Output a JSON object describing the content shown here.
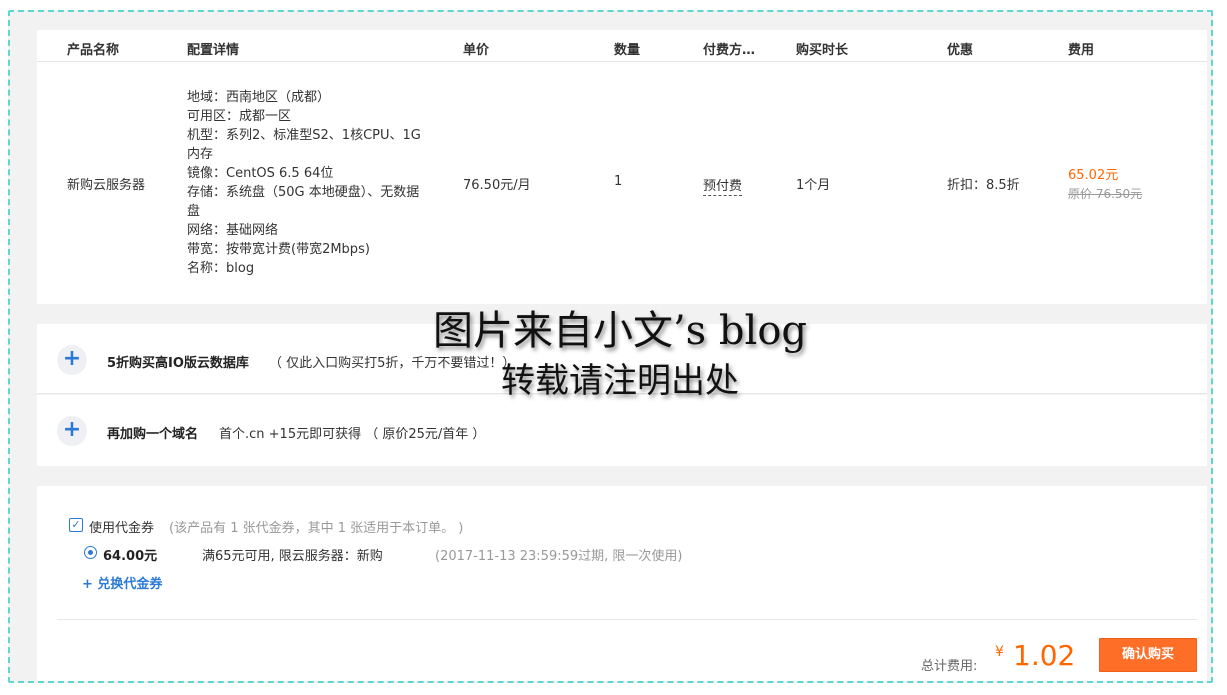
{
  "table": {
    "headers": [
      "产品名称",
      "配置详情",
      "单价",
      "数量",
      "付费方…",
      "购买时长",
      "优惠",
      "费用"
    ],
    "row": {
      "product": "新购云服务器",
      "config_lines": [
        "地域：西南地区（成都）",
        "可用区：成都一区",
        "机型：系列2、标准型S2、1核CPU、1G",
        "内存",
        "镜像：CentOS 6.5 64位",
        "存储：系统盘（50G 本地硬盘）、无数据",
        "盘",
        "网络：基础网络",
        "带宽：按带宽计费(带宽2Mbps)",
        "名称：blog"
      ],
      "unit_price": "76.50元/月",
      "quantity": "1",
      "pay_type": "预付费",
      "duration": "1个月",
      "discount": "折扣：8.5折",
      "fee_current": "65.02元",
      "fee_original": "原价 76.50元"
    }
  },
  "addons": [
    {
      "title": "5折购买高IO版云数据库",
      "desc": "（ 仅此入口购买打5折，千万不要错过！）"
    },
    {
      "title": "再加购一个域名",
      "desc": "首个.cn +15元即可获得 （ 原价25元/首年 ）"
    }
  ],
  "voucher": {
    "label": "使用代金券",
    "note": "(该产品有 1 张代金券，其中 1 张适用于本订单。 )",
    "amount": "64.00元",
    "rule": "满65元可用, 限云服务器：新购",
    "expire": "(2017-11-13 23:59:59过期, 限一次使用)",
    "exchange": "+ 兑换代金券"
  },
  "summary": {
    "total_label": "总计费用:",
    "currency": "¥",
    "total": "1.02",
    "confirm": "确认购买"
  },
  "watermark": {
    "line1": "图片来自小文’s blog",
    "line2": "转载请注明出处"
  },
  "colors": {
    "accent": "#2c7ad6",
    "price": "#ff6600",
    "button": "#ff6e26",
    "frame": "#5fd6cf"
  }
}
